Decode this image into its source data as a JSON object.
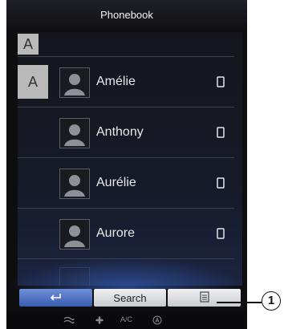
{
  "header": {
    "title": "Phonebook"
  },
  "section": {
    "letter": "A"
  },
  "contacts": [
    {
      "letter": "A",
      "name": "Amélie"
    },
    {
      "letter": "",
      "name": "Anthony"
    },
    {
      "letter": "",
      "name": "Aurélie"
    },
    {
      "letter": "",
      "name": "Aurore"
    }
  ],
  "toolbar": {
    "back_icon": "back-arrow-icon",
    "search_label": "Search",
    "menu_icon": "list-menu-icon"
  },
  "climate": {
    "ac_label": "A/C"
  },
  "callout": {
    "label": "1"
  },
  "colors": {
    "accent": "#3a5cb0",
    "background": "#0e0e10"
  }
}
